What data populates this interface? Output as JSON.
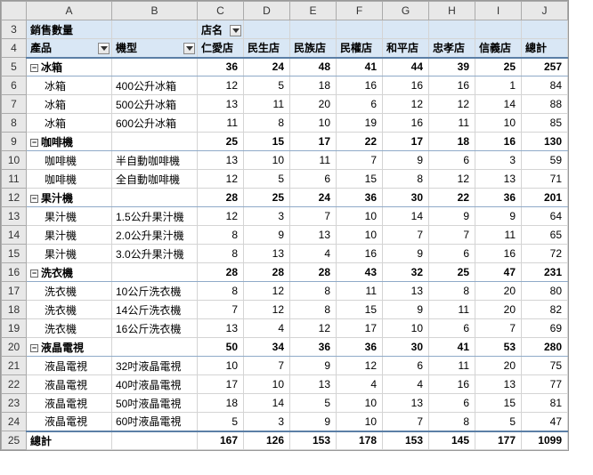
{
  "columns": [
    "A",
    "B",
    "C",
    "D",
    "E",
    "F",
    "G",
    "H",
    "I",
    "J"
  ],
  "row_numbers": [
    3,
    4,
    5,
    6,
    7,
    8,
    9,
    10,
    11,
    12,
    13,
    14,
    15,
    16,
    17,
    18,
    19,
    20,
    21,
    22,
    23,
    24,
    25
  ],
  "title_row": {
    "label_sales_qty": "銷售數量",
    "label_store_name": "店名"
  },
  "header_row": {
    "product": "產品",
    "model": "機型",
    "stores": [
      "仁愛店",
      "民生店",
      "民族店",
      "民權店",
      "和平店",
      "忠孝店",
      "信義店",
      "總計"
    ]
  },
  "groups": [
    {
      "name": "冰箱",
      "subtotal": [
        36,
        24,
        48,
        41,
        44,
        39,
        25,
        257
      ],
      "rows": [
        {
          "product": "冰箱",
          "model": "400公升冰箱",
          "values": [
            12,
            5,
            18,
            16,
            16,
            16,
            1,
            84
          ]
        },
        {
          "product": "冰箱",
          "model": "500公升冰箱",
          "values": [
            13,
            11,
            20,
            6,
            12,
            12,
            14,
            88
          ]
        },
        {
          "product": "冰箱",
          "model": "600公升冰箱",
          "values": [
            11,
            8,
            10,
            19,
            16,
            11,
            10,
            85
          ]
        }
      ]
    },
    {
      "name": "咖啡機",
      "subtotal": [
        25,
        15,
        17,
        22,
        17,
        18,
        16,
        130
      ],
      "rows": [
        {
          "product": "咖啡機",
          "model": "半自動咖啡機",
          "values": [
            13,
            10,
            11,
            7,
            9,
            6,
            3,
            59
          ]
        },
        {
          "product": "咖啡機",
          "model": "全自動咖啡機",
          "values": [
            12,
            5,
            6,
            15,
            8,
            12,
            13,
            71
          ]
        }
      ]
    },
    {
      "name": "果汁機",
      "subtotal": [
        28,
        25,
        24,
        36,
        30,
        22,
        36,
        201
      ],
      "rows": [
        {
          "product": "果汁機",
          "model": "1.5公升果汁機",
          "values": [
            12,
            3,
            7,
            10,
            14,
            9,
            9,
            64
          ]
        },
        {
          "product": "果汁機",
          "model": "2.0公升果汁機",
          "values": [
            8,
            9,
            13,
            10,
            7,
            7,
            11,
            65
          ]
        },
        {
          "product": "果汁機",
          "model": "3.0公升果汁機",
          "values": [
            8,
            13,
            4,
            16,
            9,
            6,
            16,
            72
          ]
        }
      ]
    },
    {
      "name": "洗衣機",
      "subtotal": [
        28,
        28,
        28,
        43,
        32,
        25,
        47,
        231
      ],
      "rows": [
        {
          "product": "洗衣機",
          "model": "10公斤洗衣機",
          "values": [
            8,
            12,
            8,
            11,
            13,
            8,
            20,
            80
          ]
        },
        {
          "product": "洗衣機",
          "model": "14公斤洗衣機",
          "values": [
            7,
            12,
            8,
            15,
            9,
            11,
            20,
            82
          ]
        },
        {
          "product": "洗衣機",
          "model": "16公斤洗衣機",
          "values": [
            13,
            4,
            12,
            17,
            10,
            6,
            7,
            69
          ]
        }
      ]
    },
    {
      "name": "液晶電視",
      "subtotal": [
        50,
        34,
        36,
        36,
        30,
        41,
        53,
        280
      ],
      "rows": [
        {
          "product": "液晶電視",
          "model": "32吋液晶電視",
          "values": [
            10,
            7,
            9,
            12,
            6,
            11,
            20,
            75
          ]
        },
        {
          "product": "液晶電視",
          "model": "40吋液晶電視",
          "values": [
            17,
            10,
            13,
            4,
            4,
            16,
            13,
            77
          ]
        },
        {
          "product": "液晶電視",
          "model": "50吋液晶電視",
          "values": [
            18,
            14,
            5,
            10,
            13,
            6,
            15,
            81
          ]
        },
        {
          "product": "液晶電視",
          "model": "60吋液晶電視",
          "values": [
            5,
            3,
            9,
            10,
            7,
            8,
            5,
            47
          ]
        }
      ]
    }
  ],
  "grand_total": {
    "label": "總計",
    "values": [
      167,
      126,
      153,
      178,
      153,
      145,
      177,
      1099
    ]
  },
  "chart_data": {
    "type": "table",
    "title": "銷售數量",
    "column_dimension": "店名",
    "row_dimensions": [
      "產品",
      "機型"
    ],
    "columns": [
      "仁愛店",
      "民生店",
      "民族店",
      "民權店",
      "和平店",
      "忠孝店",
      "信義店",
      "總計"
    ],
    "rows": [
      {
        "product": "冰箱",
        "model": null,
        "values": [
          36,
          24,
          48,
          41,
          44,
          39,
          25,
          257
        ],
        "is_subtotal": true
      },
      {
        "product": "冰箱",
        "model": "400公升冰箱",
        "values": [
          12,
          5,
          18,
          16,
          16,
          16,
          1,
          84
        ]
      },
      {
        "product": "冰箱",
        "model": "500公升冰箱",
        "values": [
          13,
          11,
          20,
          6,
          12,
          12,
          14,
          88
        ]
      },
      {
        "product": "冰箱",
        "model": "600公升冰箱",
        "values": [
          11,
          8,
          10,
          19,
          16,
          11,
          10,
          85
        ]
      },
      {
        "product": "咖啡機",
        "model": null,
        "values": [
          25,
          15,
          17,
          22,
          17,
          18,
          16,
          130
        ],
        "is_subtotal": true
      },
      {
        "product": "咖啡機",
        "model": "半自動咖啡機",
        "values": [
          13,
          10,
          11,
          7,
          9,
          6,
          3,
          59
        ]
      },
      {
        "product": "咖啡機",
        "model": "全自動咖啡機",
        "values": [
          12,
          5,
          6,
          15,
          8,
          12,
          13,
          71
        ]
      },
      {
        "product": "果汁機",
        "model": null,
        "values": [
          28,
          25,
          24,
          36,
          30,
          22,
          36,
          201
        ],
        "is_subtotal": true
      },
      {
        "product": "果汁機",
        "model": "1.5公升果汁機",
        "values": [
          12,
          3,
          7,
          10,
          14,
          9,
          9,
          64
        ]
      },
      {
        "product": "果汁機",
        "model": "2.0公升果汁機",
        "values": [
          8,
          9,
          13,
          10,
          7,
          7,
          11,
          65
        ]
      },
      {
        "product": "果汁機",
        "model": "3.0公升果汁機",
        "values": [
          8,
          13,
          4,
          16,
          9,
          6,
          16,
          72
        ]
      },
      {
        "product": "洗衣機",
        "model": null,
        "values": [
          28,
          28,
          28,
          43,
          32,
          25,
          47,
          231
        ],
        "is_subtotal": true
      },
      {
        "product": "洗衣機",
        "model": "10公斤洗衣機",
        "values": [
          8,
          12,
          8,
          11,
          13,
          8,
          20,
          80
        ]
      },
      {
        "product": "洗衣機",
        "model": "14公斤洗衣機",
        "values": [
          7,
          12,
          8,
          15,
          9,
          11,
          20,
          82
        ]
      },
      {
        "product": "洗衣機",
        "model": "16公斤洗衣機",
        "values": [
          13,
          4,
          12,
          17,
          10,
          6,
          7,
          69
        ]
      },
      {
        "product": "液晶電視",
        "model": null,
        "values": [
          50,
          34,
          36,
          36,
          30,
          41,
          53,
          280
        ],
        "is_subtotal": true
      },
      {
        "product": "液晶電視",
        "model": "32吋液晶電視",
        "values": [
          10,
          7,
          9,
          12,
          6,
          11,
          20,
          75
        ]
      },
      {
        "product": "液晶電視",
        "model": "40吋液晶電視",
        "values": [
          17,
          10,
          13,
          4,
          4,
          16,
          13,
          77
        ]
      },
      {
        "product": "液晶電視",
        "model": "50吋液晶電視",
        "values": [
          18,
          14,
          5,
          10,
          13,
          6,
          15,
          81
        ]
      },
      {
        "product": "液晶電視",
        "model": "60吋液晶電視",
        "values": [
          5,
          3,
          9,
          10,
          7,
          8,
          5,
          47
        ]
      },
      {
        "product": "總計",
        "model": null,
        "values": [
          167,
          126,
          153,
          178,
          153,
          145,
          177,
          1099
        ],
        "is_grand_total": true
      }
    ]
  }
}
